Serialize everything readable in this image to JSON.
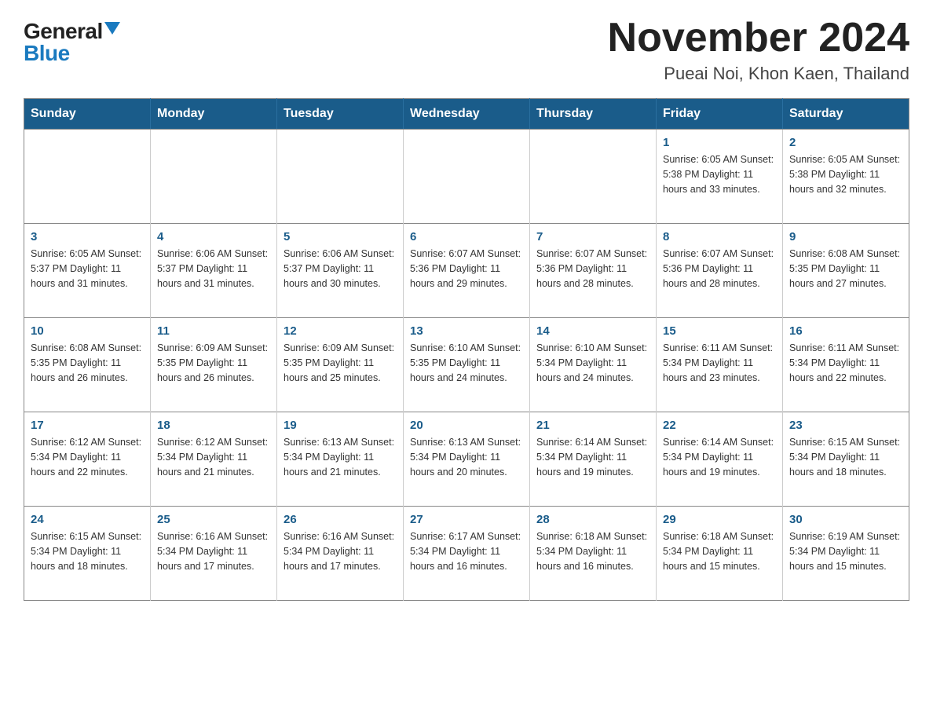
{
  "logo": {
    "general": "General",
    "blue": "Blue",
    "triangle": "▲"
  },
  "title": "November 2024",
  "subtitle": "Pueai Noi, Khon Kaen, Thailand",
  "days_of_week": [
    "Sunday",
    "Monday",
    "Tuesday",
    "Wednesday",
    "Thursday",
    "Friday",
    "Saturday"
  ],
  "weeks": [
    [
      {
        "day": "",
        "info": ""
      },
      {
        "day": "",
        "info": ""
      },
      {
        "day": "",
        "info": ""
      },
      {
        "day": "",
        "info": ""
      },
      {
        "day": "",
        "info": ""
      },
      {
        "day": "1",
        "info": "Sunrise: 6:05 AM\nSunset: 5:38 PM\nDaylight: 11 hours\nand 33 minutes."
      },
      {
        "day": "2",
        "info": "Sunrise: 6:05 AM\nSunset: 5:38 PM\nDaylight: 11 hours\nand 32 minutes."
      }
    ],
    [
      {
        "day": "3",
        "info": "Sunrise: 6:05 AM\nSunset: 5:37 PM\nDaylight: 11 hours\nand 31 minutes."
      },
      {
        "day": "4",
        "info": "Sunrise: 6:06 AM\nSunset: 5:37 PM\nDaylight: 11 hours\nand 31 minutes."
      },
      {
        "day": "5",
        "info": "Sunrise: 6:06 AM\nSunset: 5:37 PM\nDaylight: 11 hours\nand 30 minutes."
      },
      {
        "day": "6",
        "info": "Sunrise: 6:07 AM\nSunset: 5:36 PM\nDaylight: 11 hours\nand 29 minutes."
      },
      {
        "day": "7",
        "info": "Sunrise: 6:07 AM\nSunset: 5:36 PM\nDaylight: 11 hours\nand 28 minutes."
      },
      {
        "day": "8",
        "info": "Sunrise: 6:07 AM\nSunset: 5:36 PM\nDaylight: 11 hours\nand 28 minutes."
      },
      {
        "day": "9",
        "info": "Sunrise: 6:08 AM\nSunset: 5:35 PM\nDaylight: 11 hours\nand 27 minutes."
      }
    ],
    [
      {
        "day": "10",
        "info": "Sunrise: 6:08 AM\nSunset: 5:35 PM\nDaylight: 11 hours\nand 26 minutes."
      },
      {
        "day": "11",
        "info": "Sunrise: 6:09 AM\nSunset: 5:35 PM\nDaylight: 11 hours\nand 26 minutes."
      },
      {
        "day": "12",
        "info": "Sunrise: 6:09 AM\nSunset: 5:35 PM\nDaylight: 11 hours\nand 25 minutes."
      },
      {
        "day": "13",
        "info": "Sunrise: 6:10 AM\nSunset: 5:35 PM\nDaylight: 11 hours\nand 24 minutes."
      },
      {
        "day": "14",
        "info": "Sunrise: 6:10 AM\nSunset: 5:34 PM\nDaylight: 11 hours\nand 24 minutes."
      },
      {
        "day": "15",
        "info": "Sunrise: 6:11 AM\nSunset: 5:34 PM\nDaylight: 11 hours\nand 23 minutes."
      },
      {
        "day": "16",
        "info": "Sunrise: 6:11 AM\nSunset: 5:34 PM\nDaylight: 11 hours\nand 22 minutes."
      }
    ],
    [
      {
        "day": "17",
        "info": "Sunrise: 6:12 AM\nSunset: 5:34 PM\nDaylight: 11 hours\nand 22 minutes."
      },
      {
        "day": "18",
        "info": "Sunrise: 6:12 AM\nSunset: 5:34 PM\nDaylight: 11 hours\nand 21 minutes."
      },
      {
        "day": "19",
        "info": "Sunrise: 6:13 AM\nSunset: 5:34 PM\nDaylight: 11 hours\nand 21 minutes."
      },
      {
        "day": "20",
        "info": "Sunrise: 6:13 AM\nSunset: 5:34 PM\nDaylight: 11 hours\nand 20 minutes."
      },
      {
        "day": "21",
        "info": "Sunrise: 6:14 AM\nSunset: 5:34 PM\nDaylight: 11 hours\nand 19 minutes."
      },
      {
        "day": "22",
        "info": "Sunrise: 6:14 AM\nSunset: 5:34 PM\nDaylight: 11 hours\nand 19 minutes."
      },
      {
        "day": "23",
        "info": "Sunrise: 6:15 AM\nSunset: 5:34 PM\nDaylight: 11 hours\nand 18 minutes."
      }
    ],
    [
      {
        "day": "24",
        "info": "Sunrise: 6:15 AM\nSunset: 5:34 PM\nDaylight: 11 hours\nand 18 minutes."
      },
      {
        "day": "25",
        "info": "Sunrise: 6:16 AM\nSunset: 5:34 PM\nDaylight: 11 hours\nand 17 minutes."
      },
      {
        "day": "26",
        "info": "Sunrise: 6:16 AM\nSunset: 5:34 PM\nDaylight: 11 hours\nand 17 minutes."
      },
      {
        "day": "27",
        "info": "Sunrise: 6:17 AM\nSunset: 5:34 PM\nDaylight: 11 hours\nand 16 minutes."
      },
      {
        "day": "28",
        "info": "Sunrise: 6:18 AM\nSunset: 5:34 PM\nDaylight: 11 hours\nand 16 minutes."
      },
      {
        "day": "29",
        "info": "Sunrise: 6:18 AM\nSunset: 5:34 PM\nDaylight: 11 hours\nand 15 minutes."
      },
      {
        "day": "30",
        "info": "Sunrise: 6:19 AM\nSunset: 5:34 PM\nDaylight: 11 hours\nand 15 minutes."
      }
    ]
  ],
  "colors": {
    "header_bg": "#1a5c8a",
    "header_text": "#ffffff",
    "border": "#888888",
    "day_number": "#1a5c8a"
  }
}
